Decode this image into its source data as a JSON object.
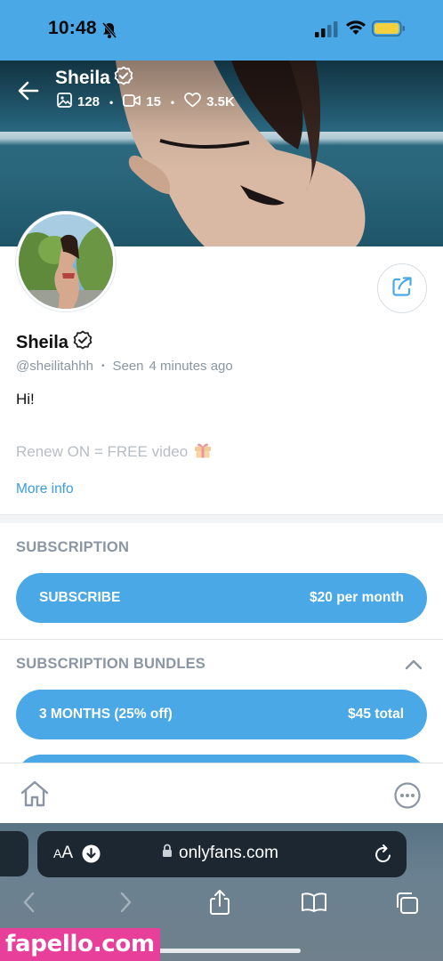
{
  "status_bar": {
    "time": "10:48"
  },
  "header": {
    "name": "Sheila",
    "stats": {
      "photos": "128",
      "videos": "15",
      "likes": "3.5K"
    }
  },
  "profile": {
    "name": "Sheila",
    "username": "@sheilitahhh",
    "seen_label": "Seen",
    "seen_time": "4 minutes ago",
    "bio_line_1": "Hi!",
    "bio_line_2": "Renew ON = FREE video",
    "more_info": "More info"
  },
  "subscription": {
    "title": "SUBSCRIPTION",
    "button_label": "SUBSCRIBE",
    "button_price": "$20 per month"
  },
  "bundles": {
    "title": "SUBSCRIPTION BUNDLES",
    "items": [
      {
        "label": "3 MONTHS (25% off)",
        "price": "$45 total"
      }
    ]
  },
  "browser": {
    "aa_label": "AA",
    "url": "onlyfans.com"
  },
  "watermark": "fapello.com",
  "colors": {
    "accent": "#4aa8e6",
    "muted": "#8a96a3",
    "link": "#3b9ce0"
  }
}
